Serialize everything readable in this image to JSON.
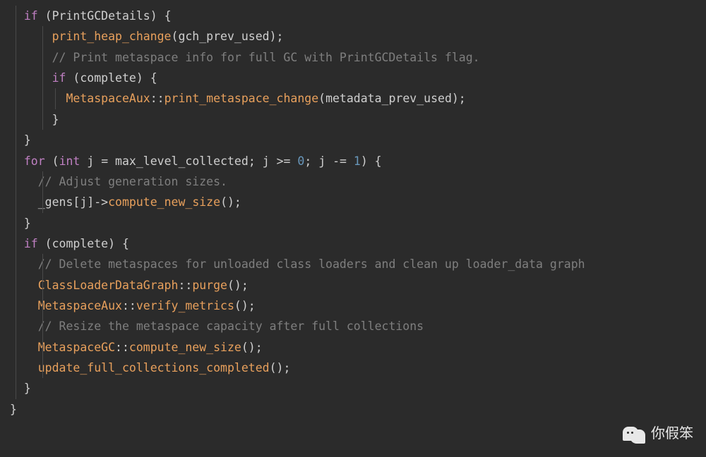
{
  "code": {
    "lines": [
      {
        "indent": 1,
        "guides": [
          1
        ],
        "tokens": [
          {
            "cls": "kw",
            "t": "if"
          },
          {
            "cls": "br",
            "t": " ("
          },
          {
            "cls": "id",
            "t": "PrintGCDetails"
          },
          {
            "cls": "br",
            "t": ") {"
          }
        ]
      },
      {
        "indent": 3,
        "guides": [
          1,
          2
        ],
        "tokens": [
          {
            "cls": "fn",
            "t": "print_heap_change"
          },
          {
            "cls": "br",
            "t": "("
          },
          {
            "cls": "id",
            "t": "gch_prev_used"
          },
          {
            "cls": "br",
            "t": ");"
          }
        ]
      },
      {
        "indent": 0,
        "guides": [
          1,
          2
        ],
        "tokens": []
      },
      {
        "indent": 3,
        "guides": [
          1,
          2
        ],
        "tokens": [
          {
            "cls": "cm",
            "t": "// Print metaspace info for full GC with PrintGCDetails flag."
          }
        ]
      },
      {
        "indent": 3,
        "guides": [
          1,
          2
        ],
        "tokens": [
          {
            "cls": "kw",
            "t": "if"
          },
          {
            "cls": "br",
            "t": " ("
          },
          {
            "cls": "id",
            "t": "complete"
          },
          {
            "cls": "br",
            "t": ") {"
          }
        ]
      },
      {
        "indent": 4,
        "guides": [
          1,
          2,
          3
        ],
        "tokens": [
          {
            "cls": "fn",
            "t": "MetaspaceAux"
          },
          {
            "cls": "br",
            "t": "::"
          },
          {
            "cls": "fn",
            "t": "print_metaspace_change"
          },
          {
            "cls": "br",
            "t": "("
          },
          {
            "cls": "id",
            "t": "metadata_prev_used"
          },
          {
            "cls": "br",
            "t": ");"
          }
        ]
      },
      {
        "indent": 3,
        "guides": [
          1,
          2
        ],
        "tokens": [
          {
            "cls": "br",
            "t": "}"
          }
        ]
      },
      {
        "indent": 1,
        "guides": [
          1
        ],
        "tokens": [
          {
            "cls": "br",
            "t": "}"
          }
        ]
      },
      {
        "indent": 0,
        "guides": [
          1
        ],
        "tokens": []
      },
      {
        "indent": 1,
        "guides": [
          1
        ],
        "tokens": [
          {
            "cls": "kw",
            "t": "for"
          },
          {
            "cls": "br",
            "t": " ("
          },
          {
            "cls": "ty",
            "t": "int"
          },
          {
            "cls": "id",
            "t": " j "
          },
          {
            "cls": "op",
            "t": "="
          },
          {
            "cls": "id",
            "t": " max_level_collected"
          },
          {
            "cls": "br",
            "t": "; "
          },
          {
            "cls": "id",
            "t": "j "
          },
          {
            "cls": "op",
            "t": ">="
          },
          {
            "cls": "num",
            "t": " 0"
          },
          {
            "cls": "br",
            "t": "; "
          },
          {
            "cls": "id",
            "t": "j "
          },
          {
            "cls": "op",
            "t": "-="
          },
          {
            "cls": "num",
            "t": " 1"
          },
          {
            "cls": "br",
            "t": ") {"
          }
        ]
      },
      {
        "indent": 2,
        "guides": [
          1,
          2
        ],
        "tokens": [
          {
            "cls": "cm",
            "t": "// Adjust generation sizes."
          }
        ]
      },
      {
        "indent": 2,
        "guides": [
          1,
          2
        ],
        "tokens": [
          {
            "cls": "id",
            "t": "_gens"
          },
          {
            "cls": "br",
            "t": "["
          },
          {
            "cls": "id",
            "t": "j"
          },
          {
            "cls": "br",
            "t": "]->"
          },
          {
            "cls": "fn",
            "t": "compute_new_size"
          },
          {
            "cls": "br",
            "t": "();"
          }
        ]
      },
      {
        "indent": 1,
        "guides": [
          1
        ],
        "tokens": [
          {
            "cls": "br",
            "t": "}"
          }
        ]
      },
      {
        "indent": 0,
        "guides": [
          1
        ],
        "tokens": []
      },
      {
        "indent": 1,
        "guides": [
          1
        ],
        "tokens": [
          {
            "cls": "kw",
            "t": "if"
          },
          {
            "cls": "br",
            "t": " ("
          },
          {
            "cls": "id",
            "t": "complete"
          },
          {
            "cls": "br",
            "t": ") {"
          }
        ]
      },
      {
        "indent": 2,
        "guides": [
          1,
          2
        ],
        "tokens": [
          {
            "cls": "cm",
            "t": "// Delete metaspaces for unloaded class loaders and clean up loader_data graph"
          }
        ]
      },
      {
        "indent": 2,
        "guides": [
          1,
          2
        ],
        "tokens": [
          {
            "cls": "fn",
            "t": "ClassLoaderDataGraph"
          },
          {
            "cls": "br",
            "t": "::"
          },
          {
            "cls": "fn",
            "t": "purge"
          },
          {
            "cls": "br",
            "t": "();"
          }
        ]
      },
      {
        "indent": 2,
        "guides": [
          1,
          2
        ],
        "tokens": [
          {
            "cls": "fn",
            "t": "MetaspaceAux"
          },
          {
            "cls": "br",
            "t": "::"
          },
          {
            "cls": "fn",
            "t": "verify_metrics"
          },
          {
            "cls": "br",
            "t": "();"
          }
        ]
      },
      {
        "indent": 2,
        "guides": [
          1,
          2
        ],
        "tokens": [
          {
            "cls": "cm",
            "t": "// Resize the metaspace capacity after full collections"
          }
        ]
      },
      {
        "indent": 2,
        "guides": [
          1,
          2
        ],
        "tokens": [
          {
            "cls": "fn",
            "t": "MetaspaceGC"
          },
          {
            "cls": "br",
            "t": "::"
          },
          {
            "cls": "fn",
            "t": "compute_new_size"
          },
          {
            "cls": "br",
            "t": "();"
          }
        ]
      },
      {
        "indent": 2,
        "guides": [
          1,
          2
        ],
        "tokens": [
          {
            "cls": "fn",
            "t": "update_full_collections_completed"
          },
          {
            "cls": "br",
            "t": "();"
          }
        ]
      },
      {
        "indent": 1,
        "guides": [
          1
        ],
        "tokens": [
          {
            "cls": "br",
            "t": "}"
          }
        ]
      },
      {
        "indent": 0,
        "guides": [],
        "tokens": [
          {
            "cls": "br",
            "t": "}"
          }
        ]
      }
    ]
  },
  "indent_spaces": [
    "",
    "  ",
    "    ",
    "      ",
    "        "
  ],
  "watermark": {
    "text": "你假笨"
  }
}
